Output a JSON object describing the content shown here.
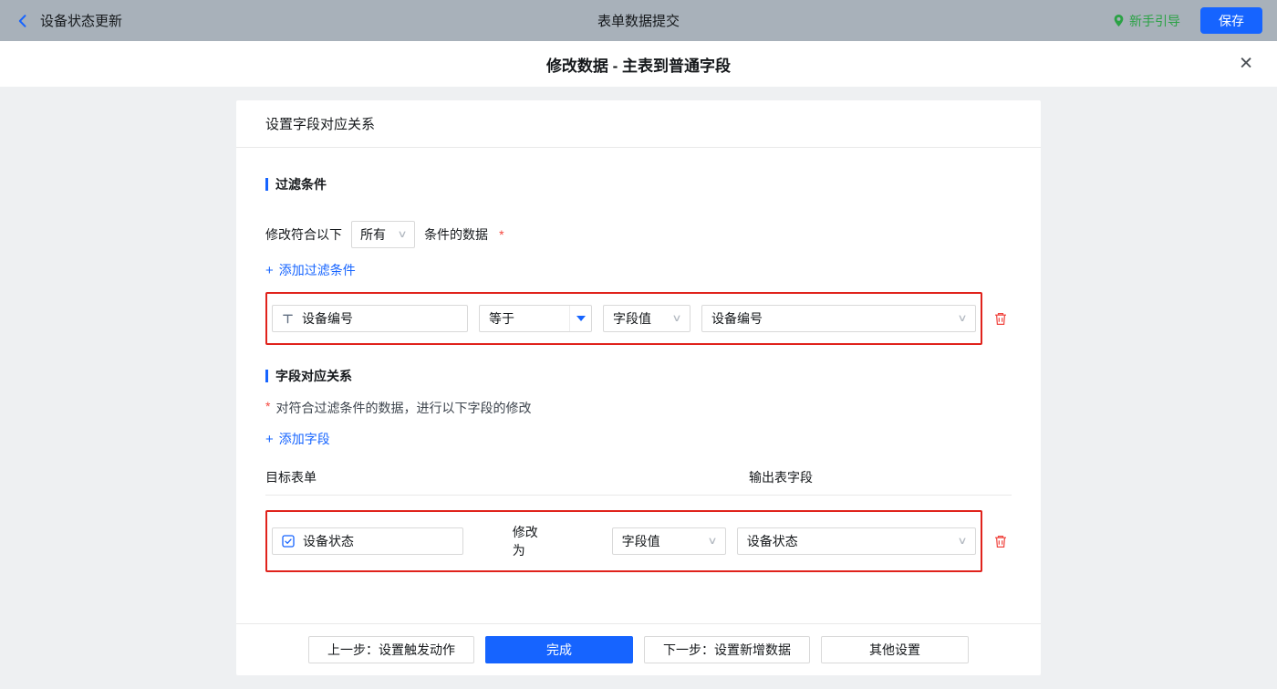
{
  "icons": {
    "chevron_down": "∨",
    "plus": "+",
    "close": "✕"
  },
  "colors": {
    "accent": "#1664ff",
    "success": "#2ba245",
    "danger": "#e0231c",
    "topbar_bg": "#a8b1ba"
  },
  "topbar": {
    "back_title": "设备状态更新",
    "center_title": "表单数据提交",
    "guide": "新手引导",
    "save": "保存"
  },
  "dialog": {
    "title": "修改数据 - 主表到普通字段"
  },
  "panel": {
    "header": "设置字段对应关系",
    "filter": {
      "section_title": "过滤条件",
      "match_prefix": "修改符合以下",
      "match_value": "所有",
      "match_suffix": "条件的数据",
      "required": "*",
      "add_label": "添加过滤条件",
      "row": {
        "field": "设备编号",
        "operator": "等于",
        "value_type": "字段值",
        "value": "设备编号"
      }
    },
    "mapping": {
      "section_title": "字段对应关系",
      "required": "*",
      "description": "对符合过滤条件的数据，进行以下字段的修改",
      "add_label": "添加字段",
      "column_target": "目标表单",
      "column_output": "输出表字段",
      "row": {
        "field": "设备状态",
        "action": "修改为",
        "value_type": "字段值",
        "value": "设备状态"
      }
    },
    "footer": {
      "prev": "上一步：设置触发动作",
      "done": "完成",
      "next": "下一步：设置新增数据",
      "other": "其他设置"
    }
  }
}
